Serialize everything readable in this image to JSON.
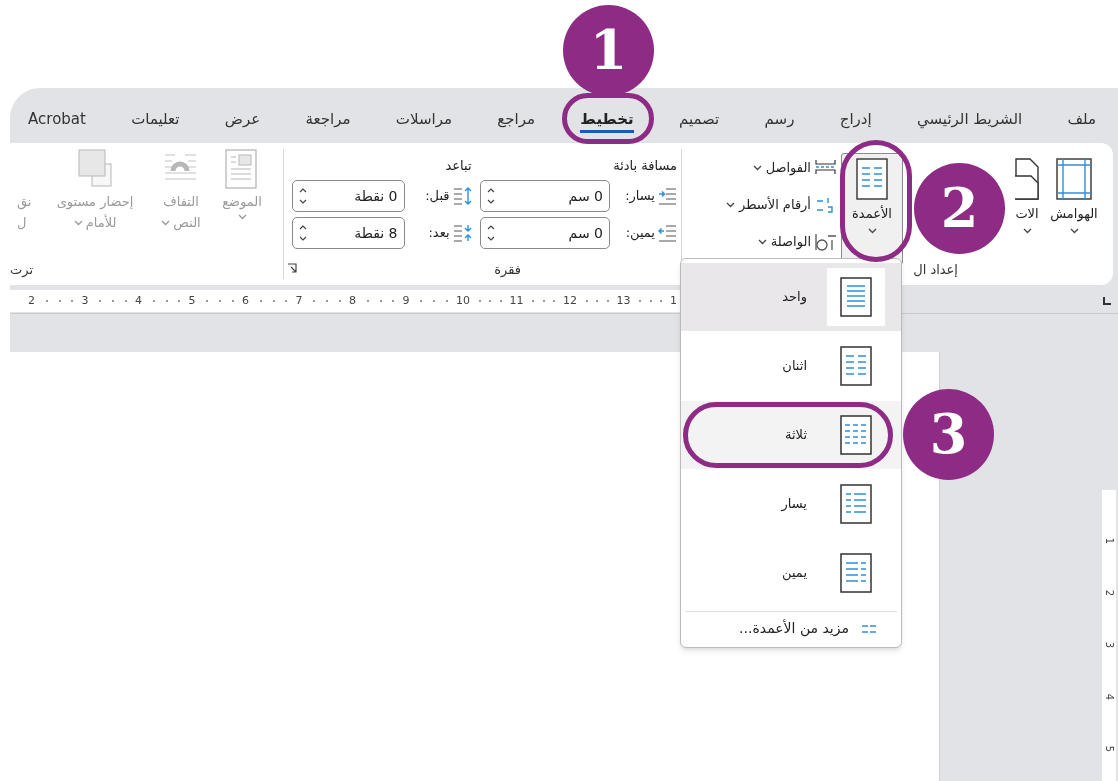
{
  "tabs": [
    {
      "label": "ملف",
      "selected": false
    },
    {
      "label": "الشريط الرئيسي",
      "selected": false
    },
    {
      "label": "إدراج",
      "selected": false
    },
    {
      "label": "رسم",
      "selected": false
    },
    {
      "label": "تصميم",
      "selected": false
    },
    {
      "label": "تخطيط",
      "selected": true
    },
    {
      "label": "مراجع",
      "selected": false
    },
    {
      "label": "مراسلات",
      "selected": false
    },
    {
      "label": "مراجعة",
      "selected": false
    },
    {
      "label": "عرض",
      "selected": false
    },
    {
      "label": "تعليمات",
      "selected": false
    },
    {
      "label": "Acrobat",
      "selected": false
    }
  ],
  "page_setup": {
    "label": "إعداد ال",
    "large_buttons": [
      {
        "label": "الهوامش",
        "kind": "margins",
        "pressed": false
      },
      {
        "label": "الات",
        "kind": "orientation",
        "pressed": false
      },
      {
        "label": "الأعمدة",
        "kind": "columns",
        "pressed": true
      }
    ],
    "small_buttons": [
      {
        "label": "الفواصل",
        "kind": "breaks"
      },
      {
        "label": "أرقام الأسطر",
        "kind": "line_numbers"
      },
      {
        "label": "الواصلة",
        "kind": "hyphenation"
      }
    ]
  },
  "paragraph": {
    "label": "فقرة",
    "indent": {
      "title": "مسافة بادئة",
      "fields": [
        {
          "label": "يسار:",
          "value": "0 سم",
          "kind": "left"
        },
        {
          "label": "يمين:",
          "value": "0 سم",
          "kind": "right"
        }
      ]
    },
    "spacing": {
      "title": "تباعد",
      "fields": [
        {
          "label": "قبل:",
          "value": "0 نقطة",
          "kind": "before"
        },
        {
          "label": "بعد:",
          "value": "8 نقطة",
          "kind": "after"
        }
      ]
    }
  },
  "arrange": {
    "label": "ترت",
    "buttons": [
      {
        "lines": [
          "الموضع"
        ],
        "kind": "position",
        "disabled": true
      },
      {
        "lines": [
          "التفاف",
          "النص"
        ],
        "kind": "wrap",
        "disabled": true
      },
      {
        "lines": [
          "إحضار مستوى",
          "للأمام"
        ],
        "kind": "forward",
        "disabled": true
      },
      {
        "lines": [
          "نق",
          "ل"
        ],
        "kind": "backward",
        "disabled": true
      }
    ]
  },
  "ruler": [
    "1",
    "13",
    "12",
    "11",
    "10",
    "9",
    "8",
    "7",
    "6",
    "5",
    "4",
    "3",
    "2"
  ],
  "vertical_ruler": [
    "1",
    "2",
    "3",
    "4",
    "5"
  ],
  "columns_menu": {
    "items": [
      {
        "label": "واحد",
        "kind": "one",
        "selected": true,
        "hovered": false
      },
      {
        "label": "اثنان",
        "kind": "two",
        "selected": false,
        "hovered": false
      },
      {
        "label": "ثلاثة",
        "kind": "three",
        "selected": false,
        "hovered": true
      },
      {
        "label": "يسار",
        "kind": "left",
        "selected": false,
        "hovered": false
      },
      {
        "label": "يمين",
        "kind": "right",
        "selected": false,
        "hovered": false
      }
    ],
    "more": "مزيد من الأعمدة..."
  },
  "annotations": [
    {
      "label": "1"
    },
    {
      "label": "2"
    },
    {
      "label": "3"
    }
  ]
}
